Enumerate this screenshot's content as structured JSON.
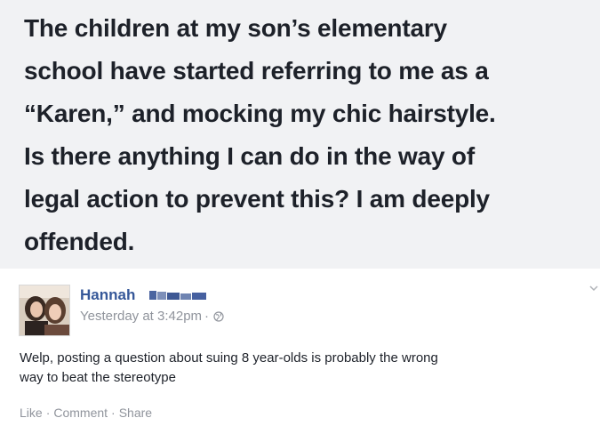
{
  "post": {
    "text_lines": [
      "The children at my son’s elementary",
      "school have started referring to me as a",
      "“Karen,” and mocking my chic hairstyle.",
      "Is there anything I can do in the way of",
      "legal action to prevent this? I am deeply",
      "offended."
    ],
    "background_color": "#f1f2f4"
  },
  "comment": {
    "author_name": "Hannah",
    "timestamp": "Yesterday at 3:42pm",
    "separator": "·",
    "privacy_icon": "globe-icon",
    "text_lines": [
      "Welp, posting a question about suing 8 year-olds is probably the wrong",
      "way to beat the stereotype"
    ],
    "actions": {
      "like": "Like",
      "comment": "Comment",
      "share": "Share",
      "separator": "·"
    },
    "link_color": "#365899",
    "meta_color": "#90949c"
  }
}
